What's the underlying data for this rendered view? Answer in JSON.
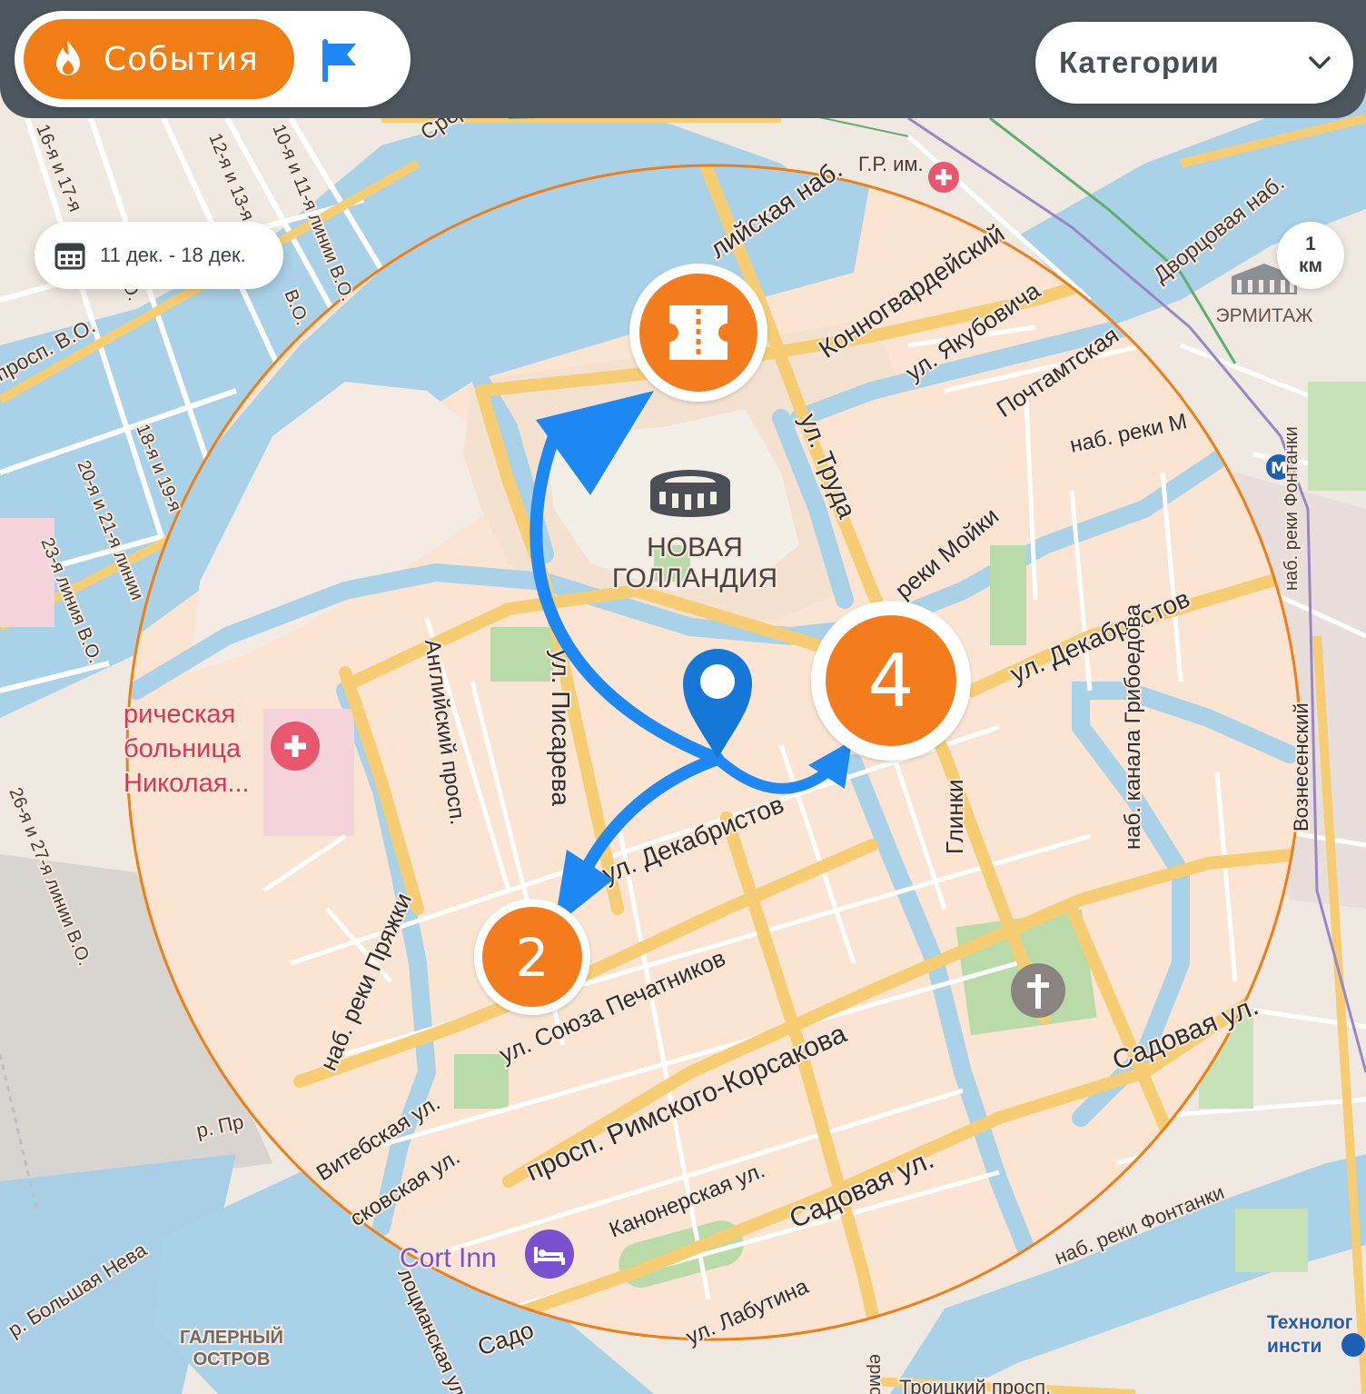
{
  "app_bar": {
    "events_label": "События",
    "events_icon": "flame-icon",
    "flag_icon": "flag-icon",
    "categories_label": "Категории",
    "categories_icon": "chevron-down-icon",
    "accent_color": "#f07e14",
    "flag_color": "#1e88f2"
  },
  "date_filter": {
    "icon": "calendar-icon",
    "label": "11 дек. - 18 дек."
  },
  "scale": {
    "value": "1",
    "unit": "км"
  },
  "map": {
    "pois": [
      {
        "name": "new-holland-label",
        "lines": [
          "НОВАЯ",
          "ГОЛЛАНДИЯ"
        ]
      },
      {
        "name": "hermitage-label",
        "lines": [
          "ЭРМИТАЖ"
        ]
      },
      {
        "name": "galerny-island-label",
        "lines": [
          "ГАЛЕРНЫЙ",
          "ОСТРОВ"
        ]
      },
      {
        "name": "hospital-label",
        "lines": [
          "рическая",
          "больница",
          "Николая..."
        ]
      },
      {
        "name": "hotel-label",
        "lines": [
          "Cort Inn"
        ]
      },
      {
        "name": "institute-label",
        "lines": [
          "Технолог",
          "инсти"
        ]
      }
    ],
    "streets": [
      "Средний",
      "16-я и 17-я",
      "12-я и 13-я",
      "10-я и 11-я линии В.О.",
      "18-я и 19-я",
      "20-я и 21-я линии",
      "23-я линия В.О.",
      "26-я и 27-я линии В.О.",
      "просп. В.О.",
      "В.О.",
      "В.О.",
      "лийская наб.",
      "Конногвардейский",
      "ул. Якубовича",
      "Почтамтская",
      "наб. реки М",
      "Дворцовая наб.",
      "ул. Труда",
      "реки Мойки",
      "ул. Декабристов",
      "ул. Декабристов",
      "ул. Писарева",
      "Английский просп.",
      "наб. реки Пряжки",
      "ул. Союза Печатников",
      "просп. Римского-Корсакова",
      "Садовая ул.",
      "Садовая ул.",
      "Витебская ул.",
      "сковская ул.",
      "Канонерская ул.",
      "ул. Лабутина",
      "Садо",
      "наб. канала Грибоедова",
      "Вознесенский",
      "Глинки",
      "наб. реки Фонтанки",
      "наб. реки Фонтанки",
      "р. Большая Нева",
      "р. Пр",
      "Троицкий просп.",
      "ермо",
      "лоцманская ул.",
      "Г.Р. им."
    ],
    "markers": [
      {
        "name": "ticket-event-marker",
        "icon": "ticket-icon",
        "label": ""
      },
      {
        "name": "cluster-marker-4",
        "icon": "",
        "label": "4"
      },
      {
        "name": "cluster-marker-2",
        "icon": "",
        "label": "2"
      }
    ],
    "user_location": {
      "icon": "map-pin-icon"
    },
    "route_arrows": {
      "color": "#1e88f2"
    },
    "colors": {
      "radius_fill": "#fbe4d1",
      "radius_stroke": "#f07e14",
      "water": "#9ccbe4",
      "park": "#b8dba9",
      "road_major": "#f6cd72",
      "marker": "#f47b1f"
    }
  }
}
